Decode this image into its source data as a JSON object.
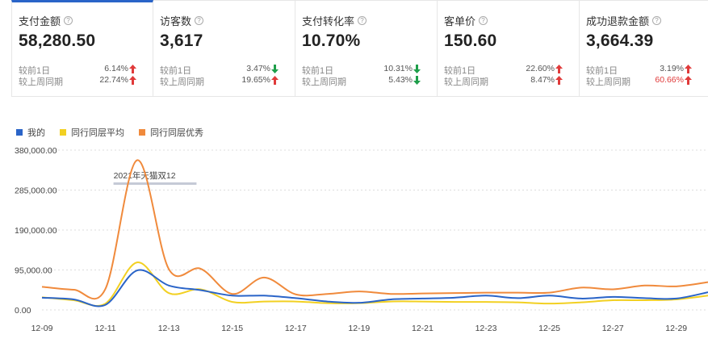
{
  "metrics": [
    {
      "title": "支付金额",
      "value": "58,280.50",
      "rows": [
        {
          "label": "较前1日",
          "value": "6.14%",
          "dir": "up",
          "red": false
        },
        {
          "label": "较上周同期",
          "value": "22.74%",
          "dir": "up",
          "red": false
        }
      ]
    },
    {
      "title": "访客数",
      "value": "3,617",
      "rows": [
        {
          "label": "较前1日",
          "value": "3.47%",
          "dir": "down",
          "red": false
        },
        {
          "label": "较上周同期",
          "value": "19.65%",
          "dir": "up",
          "red": false
        }
      ]
    },
    {
      "title": "支付转化率",
      "value": "10.70%",
      "rows": [
        {
          "label": "较前1日",
          "value": "10.31%",
          "dir": "down",
          "red": false
        },
        {
          "label": "较上周同期",
          "value": "5.43%",
          "dir": "down",
          "red": false
        }
      ]
    },
    {
      "title": "客单价",
      "value": "150.60",
      "rows": [
        {
          "label": "较前1日",
          "value": "22.60%",
          "dir": "up",
          "red": false
        },
        {
          "label": "较上周同期",
          "value": "8.47%",
          "dir": "up",
          "red": false
        }
      ]
    },
    {
      "title": "成功退款金额",
      "value": "3,664.39",
      "rows": [
        {
          "label": "较前1日",
          "value": "3.19%",
          "dir": "up",
          "red": false
        },
        {
          "label": "较上周同期",
          "value": "60.66%",
          "dir": "up",
          "red": true
        }
      ]
    }
  ],
  "help_glyph": "?",
  "icons": {
    "help": "help-circle-icon",
    "up": "arrow-up-icon",
    "down": "arrow-down-icon"
  },
  "colors": {
    "accent": "#2a64c8",
    "up_arrow": "#e03a3a",
    "down_arrow": "#1e9e4a",
    "mine": "#2a64c8",
    "avg": "#f2d022",
    "top": "#f08a3c",
    "annotation": "#c5cad6"
  },
  "chart_data": {
    "type": "line",
    "x": [
      "12-09",
      "12-10",
      "12-11",
      "12-12",
      "12-13",
      "12-14",
      "12-15",
      "12-16",
      "12-17",
      "12-18",
      "12-19",
      "12-20",
      "12-21",
      "12-22",
      "12-23",
      "12-24",
      "12-25",
      "12-26",
      "12-27",
      "12-28",
      "12-29",
      "12-30"
    ],
    "x_tick_labels": [
      "12-09",
      "12-11",
      "12-13",
      "12-15",
      "12-17",
      "12-19",
      "12-21",
      "12-23",
      "12-25",
      "12-27",
      "12-29"
    ],
    "y_ticks": [
      "0.00",
      "95,000.00",
      "190,000.00",
      "285,000.00",
      "380,000.00"
    ],
    "ylim": [
      0,
      380000
    ],
    "grid": true,
    "legend_position": "top-left",
    "series": [
      {
        "name": "我的",
        "color": "#2a64c8",
        "values": [
          29000,
          25000,
          12000,
          94000,
          58000,
          47000,
          34000,
          34000,
          28000,
          20000,
          17000,
          25000,
          27000,
          29000,
          34000,
          28000,
          34000,
          27000,
          31000,
          28000,
          27000,
          42000
        ]
      },
      {
        "name": "同行同层平均",
        "color": "#f2d022",
        "values": [
          30000,
          23000,
          15000,
          113000,
          40000,
          49000,
          19000,
          20000,
          20000,
          16000,
          16000,
          20000,
          20000,
          19000,
          19000,
          18000,
          15000,
          18000,
          23000,
          23000,
          25000,
          34000
        ]
      },
      {
        "name": "同行同层优秀",
        "color": "#f08a3c",
        "values": [
          55000,
          48000,
          50000,
          356000,
          97000,
          98000,
          38000,
          77000,
          37000,
          38000,
          44000,
          38000,
          39000,
          40000,
          41000,
          41000,
          41000,
          53000,
          49000,
          58000,
          56000,
          66000
        ]
      }
    ],
    "annotation": {
      "label": "2021年天猫双12",
      "x_start": "12-11",
      "x_end": "12-14"
    }
  }
}
